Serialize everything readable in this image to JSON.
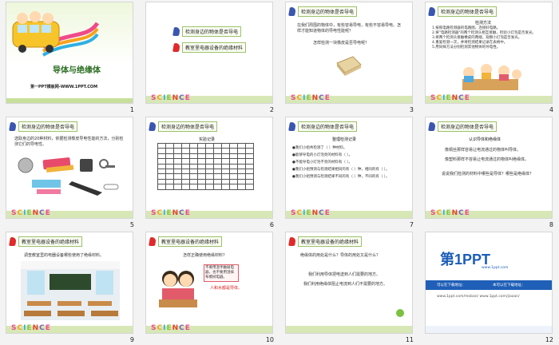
{
  "slide1": {
    "title": "导体与绝缘体",
    "footer": "第一PPT模板网-WWW.1PPT.COM",
    "number": "1"
  },
  "slide2": {
    "number": "2",
    "items": [
      "检测身边的物体是否导电",
      "教室里电器设备的绝缘材料"
    ]
  },
  "slide3": {
    "number": "3",
    "header": "检测身边的物体是否导电",
    "body": "在我们周围的物体中，有些容易导电，有些不容易导电。怎样才能知道物体的导电性能呢？",
    "question": "怎样检测一块橡皮是否导电呢？"
  },
  "slide4": {
    "number": "4",
    "header": "检测身边的物体是否导电",
    "subtitle": "检测方法",
    "steps": [
      "1.按照电路检测器的电路图，连接好电路。",
      "2.将\"电路检测器\"的两个检测头相互接触，检验小灯泡是否发光。",
      "3.将两个检测头接触橡皮的两端，观察小灯泡是否发光。",
      "4.重复检测一次，并将检测结果记录在表格中。",
      "5.用同样方法分别检测其他物体的导电性。"
    ]
  },
  "slide5": {
    "number": "5",
    "header": "检测身边的物体是否导电",
    "body": "选取身边的20种材料，依据检测橡皮导电性能的方法，分别检测它们的导电性。"
  },
  "slide6": {
    "number": "6",
    "header": "检测身边的物体是否导电",
    "table_title": "实验记录"
  },
  "slide7": {
    "number": "7",
    "header": "检测身边的物体是否导电",
    "subtitle": "整理检测记录",
    "lines": [
      "●我们小组共检测了（  ）种材料。",
      "●能够导电的小灯泡亮的材料有（  ）。",
      "●不能导电小灯泡不亮的材料有（  ）。",
      "●我们小组预测与检测结果相同的有（  ）种，相同的有（  ）。",
      "●我们小组预测与检测结果不同的有（  ）种，不同的有（  ）。"
    ]
  },
  "slide8": {
    "number": "8",
    "header": "检测身边的物体是否导电",
    "subtitle": "认识导体和绝缘体",
    "line1": "像铜丝那样容易让电流通过的物体叫导体。",
    "line2": "像塑料那样不容易让电流通过的物体叫绝缘体。",
    "question": "说说我们检测的材料中哪些是导体？哪些是绝缘体？"
  },
  "slide9": {
    "number": "9",
    "header": "教室里电器设备的绝缘材料",
    "body": "调查教室里的电器设备哪些使用了绝缘材料。"
  },
  "slide10": {
    "number": "10",
    "header": "教室里电器设备的绝缘材料",
    "question": "怎样正确使用绝缘材料？",
    "bubble": "不要用湿手触碰电器，也不要用湿抹布擦拭电器。",
    "caption": "人和水都是导体。"
  },
  "slide11": {
    "number": "11",
    "header": "教室里电器设备的绝缘材料",
    "q1": "绝缘体的用处是什么？导体的用处又是什么？",
    "a1": "我们利用导体把电送到人们需要的地方。",
    "a2": "我们利用绝缘体阻止电流到人们不需要的地方。"
  },
  "slide12": {
    "number": "12",
    "logo": "第1PPT",
    "url": "www.1ppt.com",
    "btn1": "可以在下载地址：",
    "btn2": "本可以在下载地址：",
    "desc": "www.1ppt.com/moban/ www.1ppt.com/jiaoan/"
  },
  "science_label": "SCIENCE"
}
